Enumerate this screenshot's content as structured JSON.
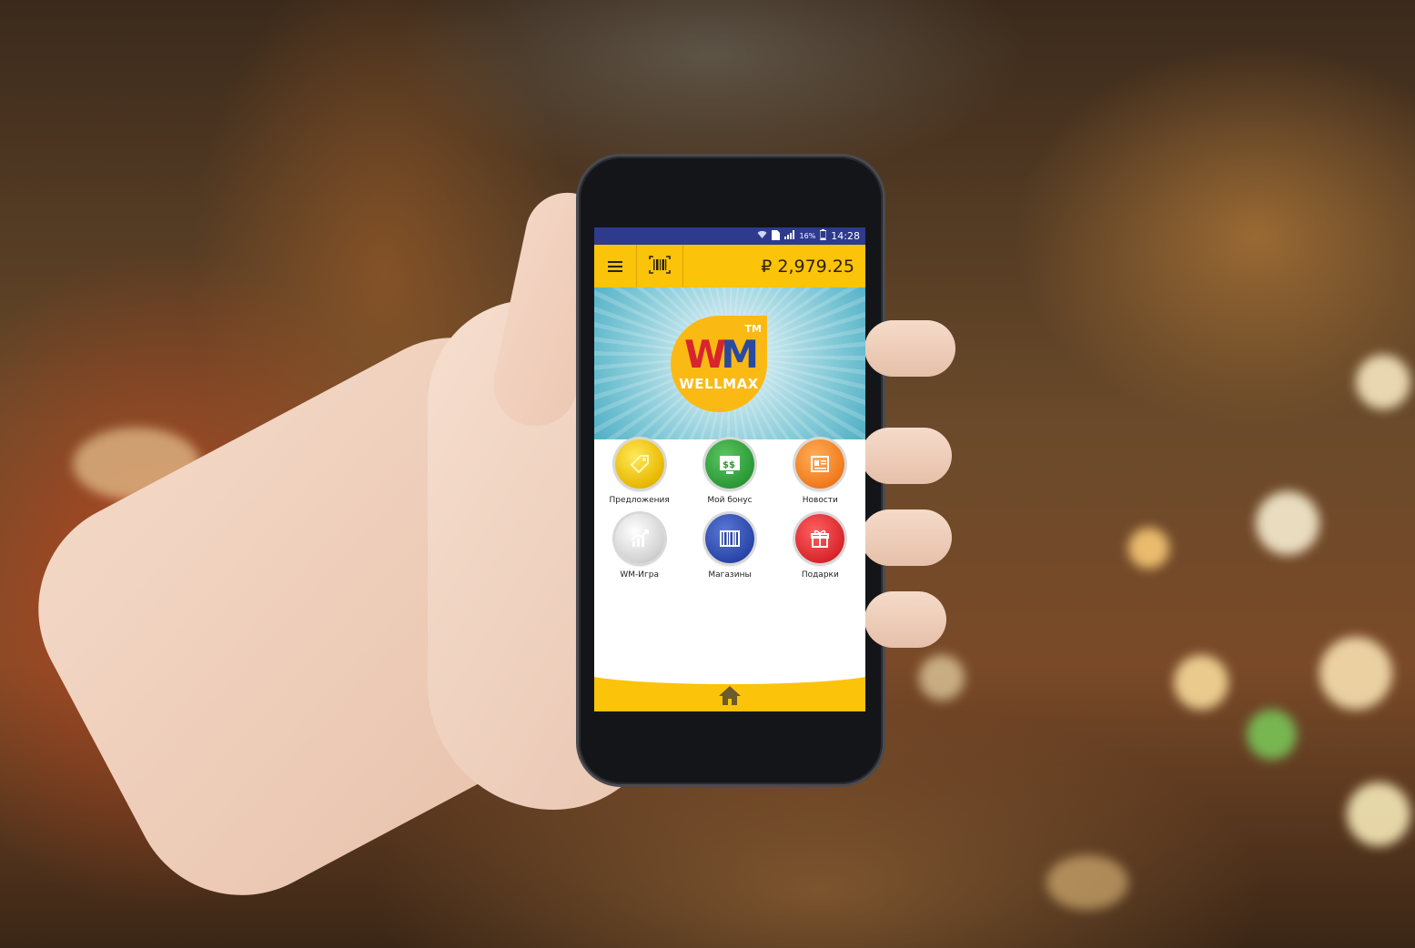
{
  "status_bar": {
    "battery_percent": "16%",
    "time": "14:28",
    "sim_slot": "1",
    "icons": [
      "wifi-icon",
      "sim-icon",
      "signal-icon",
      "battery-icon"
    ]
  },
  "app_bar": {
    "menu_icon": "hamburger-menu-icon",
    "barcode_icon": "barcode-scan-icon",
    "balance": "₽ 2,979.25"
  },
  "hero": {
    "logo_mark_w": "W",
    "logo_mark_m": "M",
    "logo_tm": "TM",
    "logo_text": "WELLMAX"
  },
  "menu": {
    "items": [
      {
        "label": "Предложения",
        "icon": "tag-icon",
        "color": "#e8b800"
      },
      {
        "label": "Мой бонус",
        "icon": "money-icon",
        "color": "#2a9a36"
      },
      {
        "label": "Новости",
        "icon": "news-icon",
        "color": "#f07a1c"
      },
      {
        "label": "WM-Игра",
        "icon": "growth-chart-icon",
        "color": "#d2d2d2"
      },
      {
        "label": "Магазины",
        "icon": "barcode-icon",
        "color": "#2a46a8"
      },
      {
        "label": "Подарки",
        "icon": "gift-icon",
        "color": "#d8262c"
      }
    ]
  },
  "bottom_bar": {
    "home_icon": "home-icon"
  },
  "colors": {
    "accent": "#fbc30a",
    "status_bar": "#2e3a8c"
  }
}
